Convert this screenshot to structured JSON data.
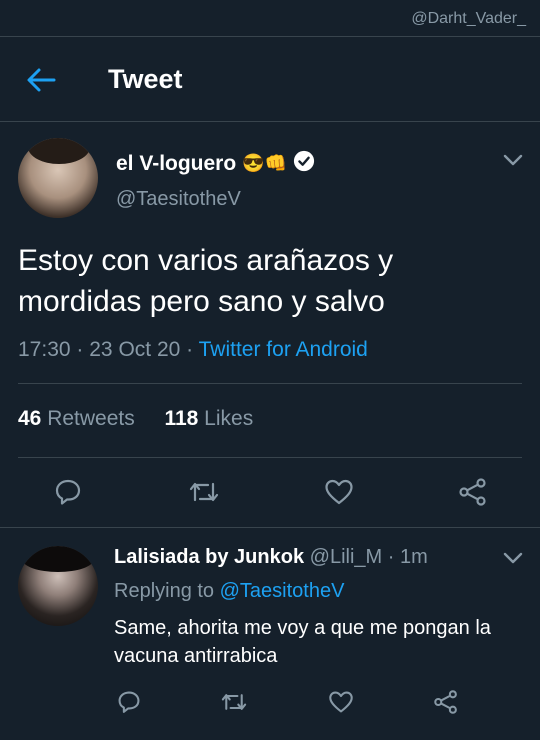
{
  "watermark": "@Darht_Vader_",
  "header": {
    "title": "Tweet"
  },
  "tweet": {
    "author_name": "el V-loguero",
    "author_emoji": "😎👊",
    "handle": "@TaesitotheV",
    "text": "Estoy con varios arañazos y mordidas pero sano y salvo",
    "time": "17:30",
    "date": "23 Oct 20",
    "separator": "·",
    "source": "Twitter for Android",
    "retweets_count": "46",
    "retweets_label": "Retweets",
    "likes_count": "118",
    "likes_label": "Likes"
  },
  "reply": {
    "author_name": "Lalisiada by Junkok",
    "handle": "@Lili_M",
    "separator": "·",
    "time": "1m",
    "replying_to_label": "Replying to",
    "replying_to_handle": "@TaesitotheV",
    "text": "Same, ahorita me voy a que me pongan la vacuna antirrabica"
  },
  "colors": {
    "background": "#15202b",
    "accent": "#1da1f2",
    "muted": "#8899a6",
    "divider": "#38444d"
  },
  "icons": [
    "back-arrow-icon",
    "verified-icon",
    "chevron-down-icon",
    "reply-icon",
    "retweet-icon",
    "like-icon",
    "share-icon"
  ]
}
